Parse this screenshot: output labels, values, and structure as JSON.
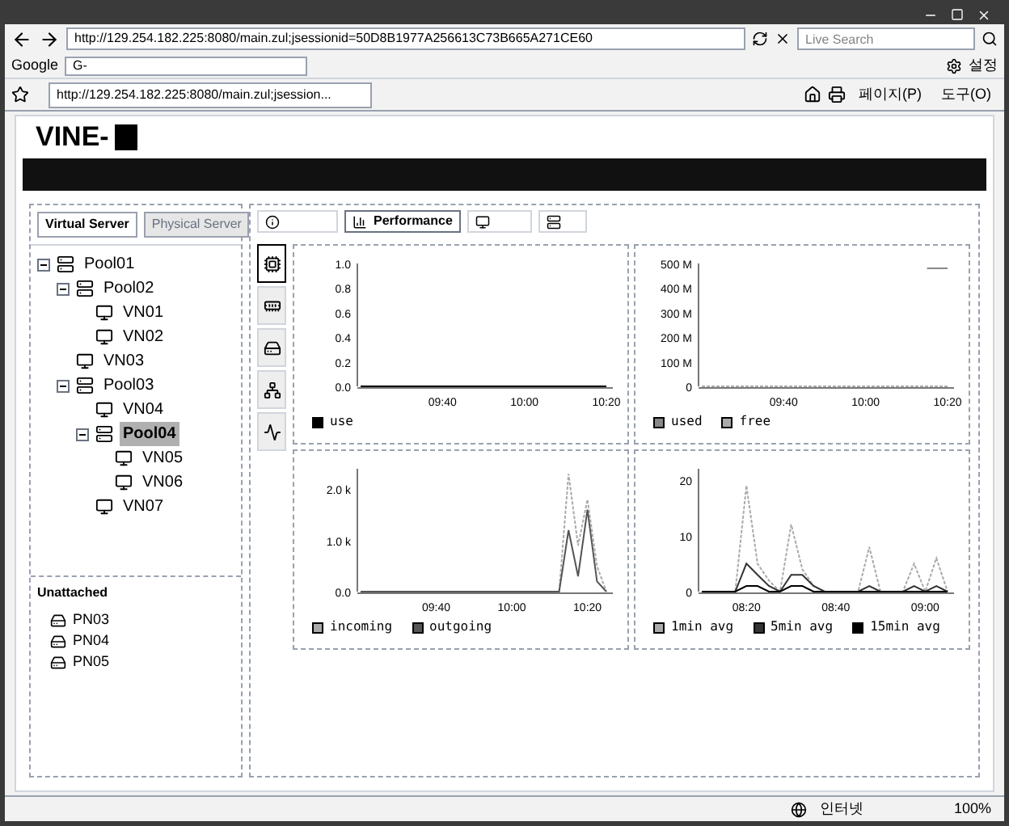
{
  "browser": {
    "address": "http://129.254.182.225:8080/main.zul;jsessionid=50D8B1977A256613C73B665A271CE60",
    "search_placeholder": "Live Search",
    "google_label": "Google",
    "google_field": "G-",
    "toolbar_right": "설정",
    "tab_title": "http://129.254.182.225:8080/main.zul;jsession...",
    "commands": [
      "페이지(P)",
      "도구(O)"
    ]
  },
  "app": {
    "logo": "VINE-",
    "side_tabs": [
      {
        "label": "Virtual Server",
        "selected": true
      },
      {
        "label": "Physical Server",
        "selected": false
      }
    ],
    "tree": [
      {
        "label": "Pool01",
        "kind": "pool",
        "expanded": true,
        "selected": false,
        "children": [
          {
            "label": "Pool02",
            "kind": "pool",
            "expanded": true,
            "selected": false,
            "children": [
              {
                "label": "VN01",
                "kind": "vm",
                "selected": false
              },
              {
                "label": "VN02",
                "kind": "vm",
                "selected": false
              }
            ]
          },
          {
            "label": "VN03",
            "kind": "vm",
            "selected": false
          },
          {
            "label": "Pool03",
            "kind": "pool",
            "expanded": true,
            "selected": false,
            "children": [
              {
                "label": "VN04",
                "kind": "vm",
                "selected": false
              },
              {
                "label": "Pool04",
                "kind": "pool",
                "expanded": true,
                "selected": true,
                "children": [
                  {
                    "label": "VN05",
                    "kind": "vm",
                    "selected": false
                  },
                  {
                    "label": "VN06",
                    "kind": "vm",
                    "selected": false
                  }
                ]
              },
              {
                "label": "VN07",
                "kind": "vm",
                "selected": false
              }
            ]
          }
        ]
      }
    ],
    "unattached_title": "Unattached",
    "unattached": [
      "PN03",
      "PN04",
      "PN05"
    ],
    "toolbar": [
      {
        "label": "Performance",
        "selected": true
      }
    ],
    "metric_tabs": [
      {
        "selected": true
      },
      {
        "selected": false
      },
      {
        "selected": false
      },
      {
        "selected": false
      },
      {
        "selected": false
      }
    ],
    "charts": [
      {
        "chart_data": {
          "type": "line",
          "categories": [
            null,
            null,
            null,
            null,
            "09:40",
            null,
            null,
            null,
            "10:00",
            null,
            null,
            null,
            "10:20"
          ],
          "ylim": [
            0,
            1.0
          ],
          "yticks": [
            {
              "value": 0,
              "label": "0.0"
            },
            {
              "value": 0.2,
              "label": "0.2"
            },
            {
              "value": 0.4,
              "label": "0.4"
            },
            {
              "value": 0.6,
              "label": "0.6"
            },
            {
              "value": 0.8,
              "label": "0.8"
            },
            {
              "value": 1.0,
              "label": "1.0"
            }
          ],
          "series": [
            {
              "name": "use",
              "color": "#000000",
              "values": [
                0,
                0,
                0,
                0,
                0,
                0,
                0,
                0,
                0,
                0,
                0,
                0,
                0
              ]
            }
          ]
        }
      },
      {
        "chart_data": {
          "type": "line",
          "categories": [
            null,
            null,
            null,
            null,
            "09:40",
            null,
            null,
            null,
            "10:00",
            null,
            null,
            null,
            "10:20"
          ],
          "ylim": [
            0,
            500
          ],
          "yticks": [
            {
              "value": 0,
              "label": "0"
            },
            {
              "value": 100,
              "label": "100 M"
            },
            {
              "value": 200,
              "label": "200 M"
            },
            {
              "value": 300,
              "label": "300 M"
            },
            {
              "value": 400,
              "label": "400 M"
            },
            {
              "value": 500,
              "label": "500 M"
            }
          ],
          "series": [
            {
              "name": "used",
              "color": "#888888",
              "values": [
                null,
                null,
                null,
                null,
                null,
                null,
                null,
                null,
                null,
                null,
                null,
                480,
                480
              ]
            },
            {
              "name": "free",
              "color": "#aaaaaa",
              "line_style": "dashed",
              "values": [
                0,
                0,
                0,
                0,
                0,
                0,
                0,
                0,
                0,
                0,
                0,
                0,
                0
              ]
            }
          ]
        }
      },
      {
        "chart_data": {
          "type": "line",
          "categories": [
            null,
            null,
            null,
            null,
            null,
            null,
            null,
            null,
            "09:40",
            null,
            null,
            null,
            null,
            null,
            null,
            null,
            "10:00",
            null,
            null,
            null,
            null,
            null,
            null,
            null,
            "10:20",
            null,
            null
          ],
          "ylim": [
            0,
            2400
          ],
          "yticks": [
            {
              "value": 0,
              "label": "0.0"
            },
            {
              "value": 1000,
              "label": "1.0 k"
            },
            {
              "value": 2000,
              "label": "2.0 k"
            }
          ],
          "series": [
            {
              "name": "incoming",
              "color": "#aaaaaa",
              "line_style": "dashed",
              "values": [
                0,
                0,
                0,
                0,
                0,
                0,
                0,
                0,
                0,
                0,
                0,
                0,
                0,
                0,
                0,
                0,
                0,
                0,
                0,
                0,
                0,
                0,
                2300,
                900,
                1800,
                500,
                0
              ]
            },
            {
              "name": "outgoing",
              "color": "#555555",
              "values": [
                0,
                0,
                0,
                0,
                0,
                0,
                0,
                0,
                0,
                0,
                0,
                0,
                0,
                0,
                0,
                0,
                0,
                0,
                0,
                0,
                0,
                0,
                1200,
                300,
                1600,
                200,
                0
              ]
            }
          ]
        }
      },
      {
        "chart_data": {
          "type": "line",
          "categories": [
            null,
            null,
            null,
            null,
            "08:20",
            null,
            null,
            null,
            null,
            null,
            null,
            null,
            "08:40",
            null,
            null,
            null,
            null,
            null,
            null,
            null,
            "09:00",
            null,
            null
          ],
          "ylim": [
            0,
            22
          ],
          "yticks": [
            {
              "value": 0,
              "label": "0"
            },
            {
              "value": 10,
              "label": "10"
            },
            {
              "value": 20,
              "label": "20"
            }
          ],
          "series": [
            {
              "name": "1min avg",
              "color": "#aaaaaa",
              "line_style": "dashed",
              "values": [
                0,
                0,
                0,
                0,
                19,
                5,
                2,
                0,
                12,
                4,
                1,
                0,
                0,
                0,
                0,
                8,
                0,
                0,
                0,
                5,
                0,
                6,
                0
              ]
            },
            {
              "name": "5min avg",
              "color": "#333333",
              "values": [
                0,
                0,
                0,
                0,
                5,
                3,
                1,
                0,
                3,
                3,
                1,
                0,
                0,
                0,
                0,
                1,
                0,
                0,
                0,
                1,
                0,
                1,
                0
              ]
            },
            {
              "name": "15min avg",
              "color": "#000000",
              "values": [
                0,
                0,
                0,
                0,
                1,
                1,
                0,
                0,
                1,
                1,
                0,
                0,
                0,
                0,
                0,
                0,
                0,
                0,
                0,
                0,
                0,
                0,
                0
              ]
            }
          ]
        }
      }
    ],
    "status": {
      "zone": "인터넷",
      "zoom": "100%"
    }
  }
}
